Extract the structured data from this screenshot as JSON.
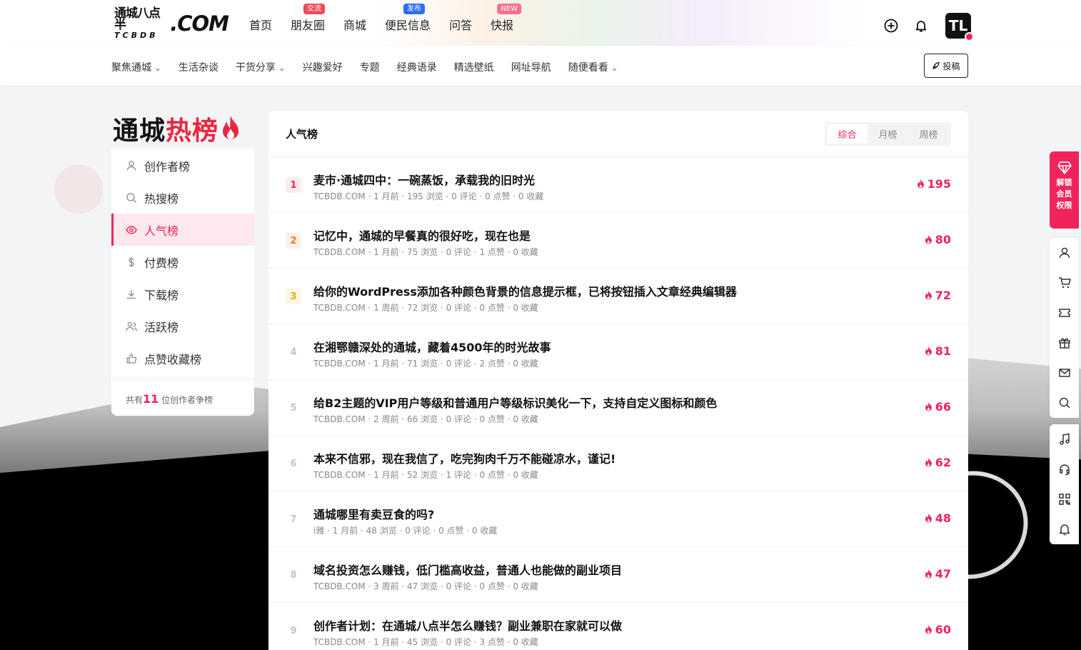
{
  "header": {
    "logo_cn": "通城八点半",
    "logo_sub": "TCBDB",
    "logo_en": ".COM",
    "nav": [
      {
        "label": "首页",
        "badge": ""
      },
      {
        "label": "朋友圈",
        "badge": "交流"
      },
      {
        "label": "商城",
        "badge": ""
      },
      {
        "label": "便民信息",
        "badge": "发布"
      },
      {
        "label": "问答",
        "badge": ""
      },
      {
        "label": "快报",
        "badge": "NEW"
      }
    ],
    "avatar_text": "TL"
  },
  "subnav": {
    "items": [
      "聚焦通城",
      "生活杂谈",
      "干货分享",
      "兴趣爱好",
      "专题",
      "经典语录",
      "精选壁纸",
      "网址导航",
      "随便看看"
    ],
    "post_label": "投稿"
  },
  "sidebar": {
    "title_a": "通城",
    "title_b": "热榜",
    "items": [
      {
        "label": "创作者榜",
        "icon": "user-icon"
      },
      {
        "label": "热搜榜",
        "icon": "search-icon"
      },
      {
        "label": "人气榜",
        "icon": "eye-icon"
      },
      {
        "label": "付费榜",
        "icon": "dollar-icon"
      },
      {
        "label": "下载榜",
        "icon": "download-icon"
      },
      {
        "label": "活跃榜",
        "icon": "users-icon"
      },
      {
        "label": "点赞收藏榜",
        "icon": "thumbs-up-icon"
      }
    ],
    "footer_prefix": "共有",
    "footer_count": "11",
    "footer_suffix": "位创作者争榜"
  },
  "main": {
    "title": "人气榜",
    "tabs": [
      "综合",
      "月榜",
      "周榜"
    ],
    "rows": [
      {
        "rank": "1",
        "title": "麦市·通城四中：一碗蒸饭，承载我的旧时光",
        "meta": "TCBDB.COM · 1 月前 · 195 浏览 · 0 评论 · 0 点赞 · 0 收藏",
        "heat": "195"
      },
      {
        "rank": "2",
        "title": "记忆中，通城的早餐真的很好吃，现在也是",
        "meta": "TCBDB.COM · 1 月前 · 75 浏览 · 0 评论 · 1 点赞 · 0 收藏",
        "heat": "80"
      },
      {
        "rank": "3",
        "title": "给你的WordPress添加各种颜色背景的信息提示框，已将按钮插入文章经典编辑器",
        "meta": "TCBDB.COM · 1 周前 · 72 浏览 · 0 评论 · 0 点赞 · 0 收藏",
        "heat": "72"
      },
      {
        "rank": "4",
        "title": "在湘鄂赣深处的通城，藏着4500年的时光故事",
        "meta": "TCBDB.COM · 1 月前 · 71 浏览 · 0 评论 · 2 点赞 · 0 收藏",
        "heat": "81"
      },
      {
        "rank": "5",
        "title": "给B2主题的VIP用户等级和普通用户等级标识美化一下，支持自定义图标和颜色",
        "meta": "TCBDB.COM · 2 周前 · 66 浏览 · 0 评论 · 0 点赞 · 0 收藏",
        "heat": "66"
      },
      {
        "rank": "6",
        "title": "本来不信邪，现在我信了，吃完狗肉千万不能碰凉水，谨记!",
        "meta": "TCBDB.COM · 1 月前 · 52 浏览 · 1 评论 · 0 点赞 · 0 收藏",
        "heat": "62"
      },
      {
        "rank": "7",
        "title": "通城哪里有卖豆食的吗?",
        "meta": "i雅 · 1 月前 · 48 浏览 · 0 评论 · 0 点赞 · 0 收藏",
        "heat": "48"
      },
      {
        "rank": "8",
        "title": "域名投资怎么赚钱，低门槛高收益，普通人也能做的副业项目",
        "meta": "TCBDB.COM · 3 周前 · 47 浏览 · 0 评论 · 0 点赞 · 0 收藏",
        "heat": "47"
      },
      {
        "rank": "9",
        "title": "创作者计划：在通城八点半怎么赚钱？副业兼职在家就可以做",
        "meta": "TCBDB.COM · 1 月前 · 45 浏览 · 0 评论 · 3 点赞 · 0 收藏",
        "heat": "60"
      }
    ]
  },
  "floating": {
    "vip_lines": [
      "解锁",
      "会员",
      "权限"
    ],
    "group1": [
      "user-icon",
      "cart-icon",
      "ticket-icon",
      "gift-icon",
      "mail-icon",
      "search-icon"
    ],
    "group2": [
      "music-icon",
      "headset-icon",
      "qrcode-icon",
      "bell-icon"
    ]
  },
  "colors": {
    "accent": "#f0245a"
  }
}
